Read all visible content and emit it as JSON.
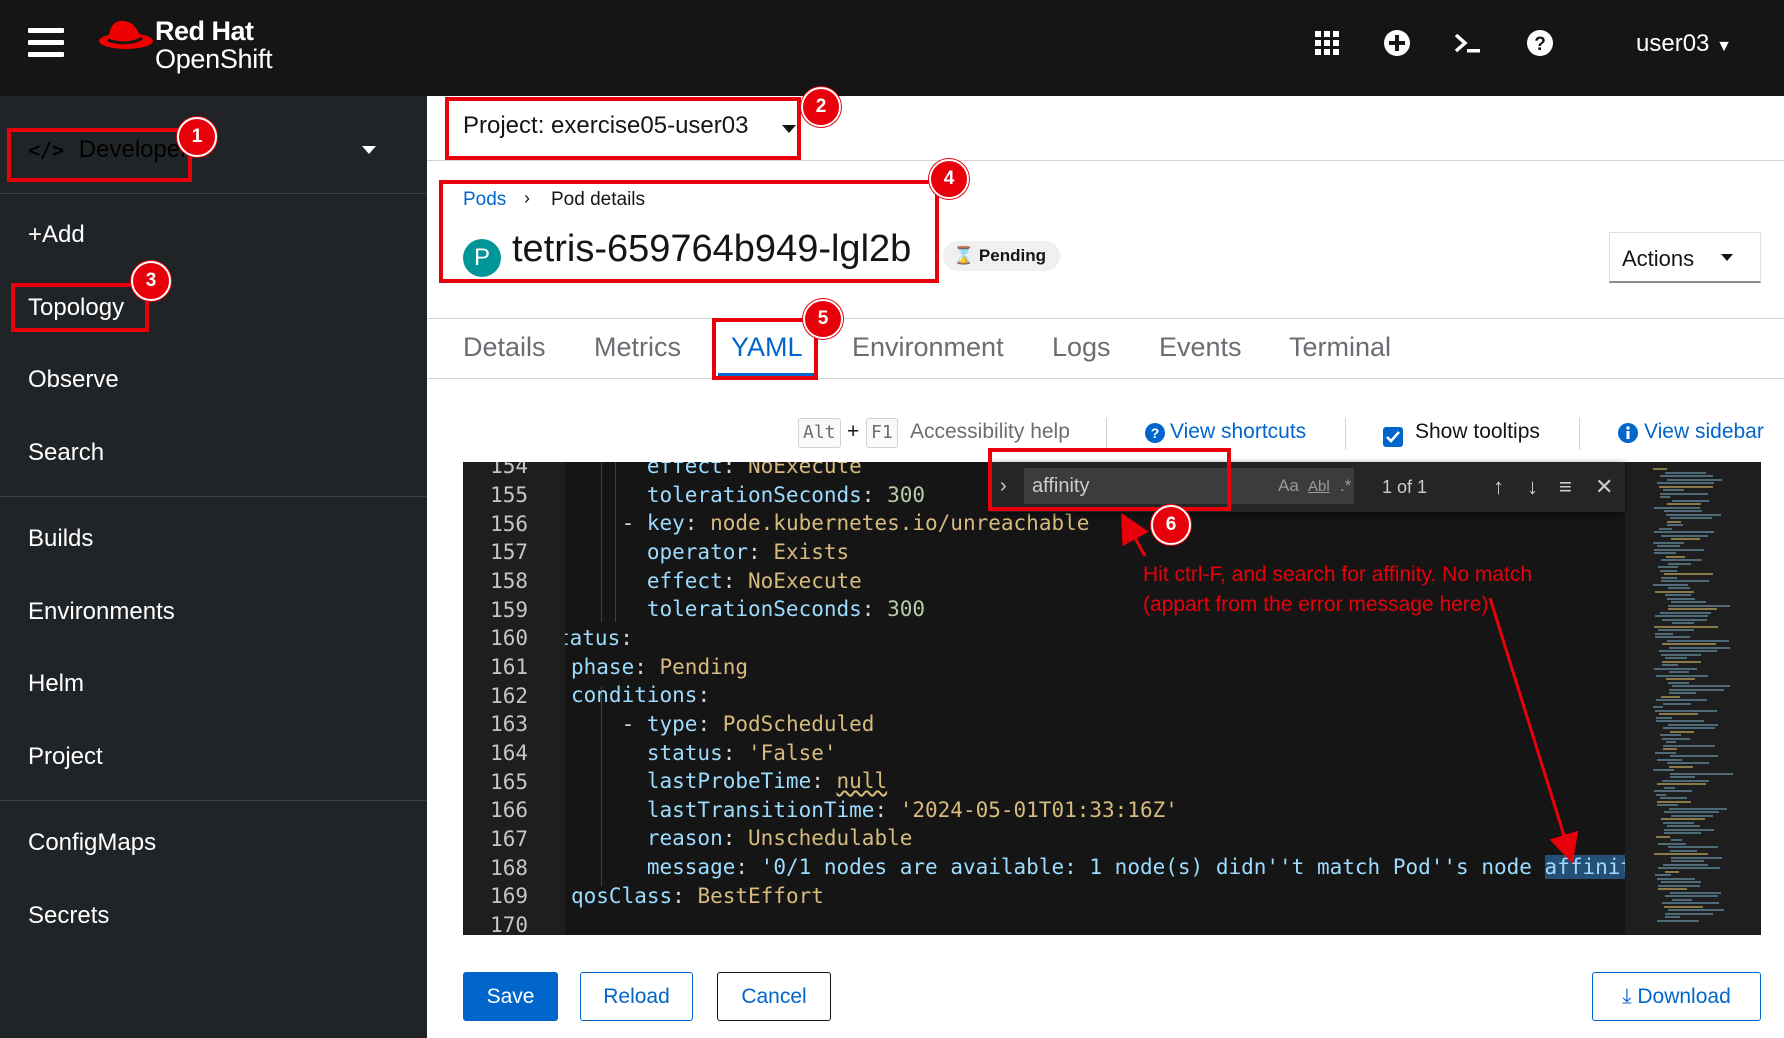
{
  "masthead": {
    "brand_line1": "Red Hat",
    "brand_line2": "OpenShift",
    "user": "user03",
    "icons": [
      "menu-icon",
      "app-launcher-icon",
      "plus-circle-icon",
      "terminal-icon",
      "help-icon"
    ]
  },
  "sidebar": {
    "perspective": "Developer",
    "items_group1": [
      "+Add",
      "Topology",
      "Observe",
      "Search"
    ],
    "items_group2": [
      "Builds",
      "Environments",
      "Helm",
      "Project"
    ],
    "items_group3": [
      "ConfigMaps",
      "Secrets"
    ]
  },
  "project": {
    "label": "Project: exercise05-user03"
  },
  "breadcrumb": {
    "link": "Pods",
    "current": "Pod details"
  },
  "pod": {
    "badge": "P",
    "name": "tetris-659764b949-lgl2b",
    "status": "Pending"
  },
  "actions": {
    "label": "Actions"
  },
  "tabs": [
    "Details",
    "Metrics",
    "YAML",
    "Environment",
    "Logs",
    "Events",
    "Terminal"
  ],
  "toolbar": {
    "kbd_alt": "Alt",
    "kbd_plus": "+",
    "kbd_f1": "F1",
    "accessibility": "Accessibility help",
    "shortcuts": "View shortcuts",
    "tooltips": "Show tooltips",
    "sidebar": "View sidebar"
  },
  "editor": {
    "line_numbers": [
      "154",
      "155",
      "156",
      "157",
      "158",
      "159",
      "160",
      "161",
      "162",
      "163",
      "164",
      "165",
      "166",
      "167",
      "168",
      "169",
      "170"
    ],
    "lines": [
      {
        "indent": "    ",
        "key": "effect",
        "sep": ": ",
        "val": "NoExecute",
        "cls": "v"
      },
      {
        "indent": "    ",
        "key": "tolerationSeconds",
        "sep": ": ",
        "val": "300",
        "cls": "n"
      },
      {
        "indent": "  - ",
        "key": "key",
        "sep": ": ",
        "val": "node.kubernetes.io/unreachable",
        "cls": "v"
      },
      {
        "indent": "    ",
        "key": "operator",
        "sep": ": ",
        "val": "Exists",
        "cls": "v"
      },
      {
        "indent": "    ",
        "key": "effect",
        "sep": ": ",
        "val": "NoExecute",
        "cls": "v"
      },
      {
        "indent": "    ",
        "key": "tolerationSeconds",
        "sep": ": ",
        "val": "300",
        "cls": "n"
      },
      {
        "indent": "",
        "key": "tatus",
        "sep": ":",
        "val": "",
        "cls": "v"
      },
      {
        "indent": "",
        "key": "phase",
        "sep": ": ",
        "val": "Pending",
        "cls": "v"
      },
      {
        "indent": "",
        "key": "conditions",
        "sep": ":",
        "val": "",
        "cls": "v"
      },
      {
        "indent": "  - ",
        "key": "type",
        "sep": ": ",
        "val": "PodScheduled",
        "cls": "v"
      },
      {
        "indent": "    ",
        "key": "status",
        "sep": ": ",
        "val": "'False'",
        "cls": "v"
      },
      {
        "indent": "    ",
        "key": "lastProbeTime",
        "sep": ": ",
        "val": "null",
        "cls": "v"
      },
      {
        "indent": "    ",
        "key": "lastTransitionTime",
        "sep": ": ",
        "val": "'2024-05-01T01:33:16Z'",
        "cls": "v"
      },
      {
        "indent": "    ",
        "key": "reason",
        "sep": ": ",
        "val": "Unschedulable",
        "cls": "v"
      },
      {
        "indent": "    ",
        "key": "message",
        "sep": ": ",
        "val": "'0/1 nodes are available: 1 node(s) didn''t match Pod''s node ",
        "match": "affinity",
        "rest": "/s",
        "cls": "k"
      },
      {
        "indent": "",
        "key": "qosClass",
        "sep": ": ",
        "val": "BestEffort",
        "cls": "v"
      },
      {
        "indent": "",
        "key": "",
        "sep": "",
        "val": "",
        "cls": "v"
      }
    ]
  },
  "find": {
    "query": "affinity",
    "opt_case": "Aa",
    "opt_word": "Abl",
    "opt_regex": ".*",
    "count": "1 of 1"
  },
  "buttons": {
    "save": "Save",
    "reload": "Reload",
    "cancel": "Cancel",
    "download": "Download"
  },
  "annotations": {
    "numbers": [
      "1",
      "2",
      "3",
      "4",
      "5",
      "6"
    ],
    "note_line1": "Hit ctrl-F, and search for affinity. No match",
    "note_line2": "(appart from the error message here)",
    "color": "#e8000b"
  },
  "colors": {
    "accent": "#0066cc",
    "masthead": "#151515",
    "sidebar": "#212427",
    "annotation": "#e8000b"
  }
}
